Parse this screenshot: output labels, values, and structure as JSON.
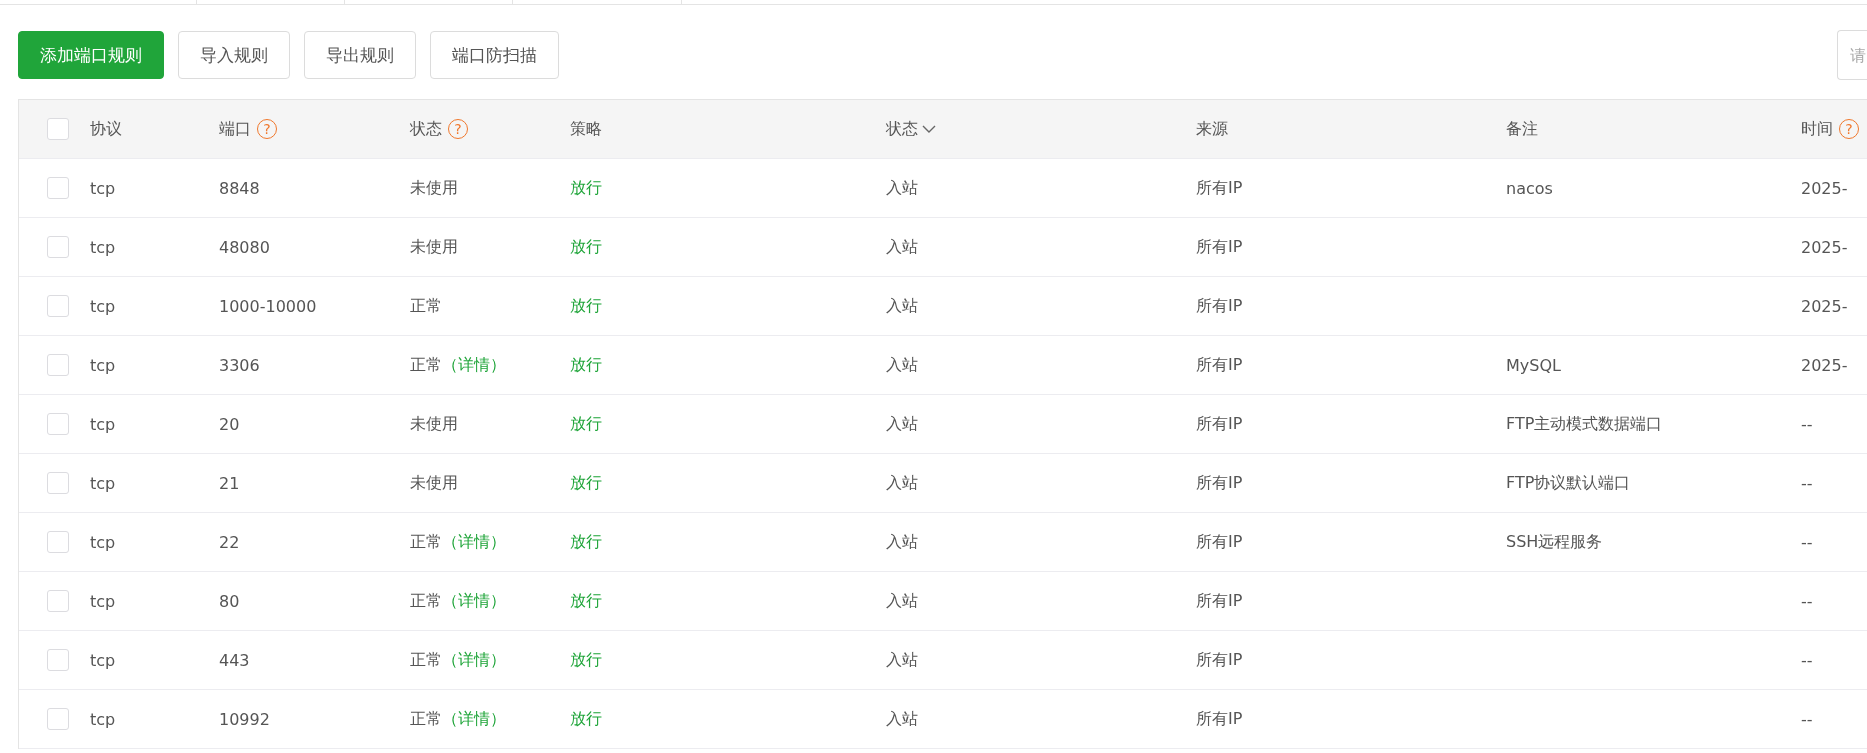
{
  "toolbar": {
    "buttons": [
      {
        "label": "添加端口规则",
        "kind": "primary"
      },
      {
        "label": "导入规则",
        "kind": "default"
      },
      {
        "label": "导出规则",
        "kind": "default"
      },
      {
        "label": "端口防扫描",
        "kind": "default"
      }
    ],
    "search": {
      "placeholder": "请"
    }
  },
  "table": {
    "select_all": {
      "checked": false
    },
    "columns": [
      {
        "label": "协议"
      },
      {
        "label": "端口",
        "help": "?"
      },
      {
        "label": "状态",
        "help": "?"
      },
      {
        "label": "策略"
      },
      {
        "label": "状态",
        "sortable": true
      },
      {
        "label": "来源"
      },
      {
        "label": "备注"
      },
      {
        "label": "时间",
        "help": "?"
      }
    ],
    "rows": [
      {
        "checked": false,
        "protocol": "tcp",
        "port": "8848",
        "status": "未使用",
        "strategy": "放行",
        "direction": "入站",
        "source": "所有IP",
        "note": "nacos",
        "time": "2025-"
      },
      {
        "checked": false,
        "protocol": "tcp",
        "port": "48080",
        "status": "未使用",
        "strategy": "放行",
        "direction": "入站",
        "source": "所有IP",
        "time": "2025-"
      },
      {
        "checked": false,
        "protocol": "tcp",
        "port": "1000-10000",
        "status": "正常",
        "strategy": "放行",
        "direction": "入站",
        "source": "所有IP",
        "time": "2025-"
      },
      {
        "checked": false,
        "protocol": "tcp",
        "port": "3306",
        "status": "正常",
        "detail": "（详情）",
        "strategy": "放行",
        "direction": "入站",
        "source": "所有IP",
        "note": "MySQL",
        "time": "2025-"
      },
      {
        "checked": false,
        "protocol": "tcp",
        "port": "20",
        "status": "未使用",
        "strategy": "放行",
        "direction": "入站",
        "source": "所有IP",
        "note": "FTP主动模式数据端口",
        "time": "--"
      },
      {
        "checked": false,
        "protocol": "tcp",
        "port": "21",
        "status": "未使用",
        "strategy": "放行",
        "direction": "入站",
        "source": "所有IP",
        "note": "FTP协议默认端口",
        "time": "--"
      },
      {
        "checked": false,
        "protocol": "tcp",
        "port": "22",
        "status": "正常",
        "detail": "（详情）",
        "strategy": "放行",
        "direction": "入站",
        "source": "所有IP",
        "note": "SSH远程服务",
        "time": "--"
      },
      {
        "checked": false,
        "protocol": "tcp",
        "port": "80",
        "status": "正常",
        "detail": "（详情）",
        "strategy": "放行",
        "direction": "入站",
        "source": "所有IP",
        "time": "--"
      },
      {
        "checked": false,
        "protocol": "tcp",
        "port": "443",
        "status": "正常",
        "detail": "（详情）",
        "strategy": "放行",
        "direction": "入站",
        "source": "所有IP",
        "time": "--"
      },
      {
        "checked": false,
        "protocol": "tcp",
        "port": "10992",
        "status": "正常",
        "detail": "（详情）",
        "strategy": "放行",
        "direction": "入站",
        "source": "所有IP",
        "time": "--"
      }
    ]
  }
}
